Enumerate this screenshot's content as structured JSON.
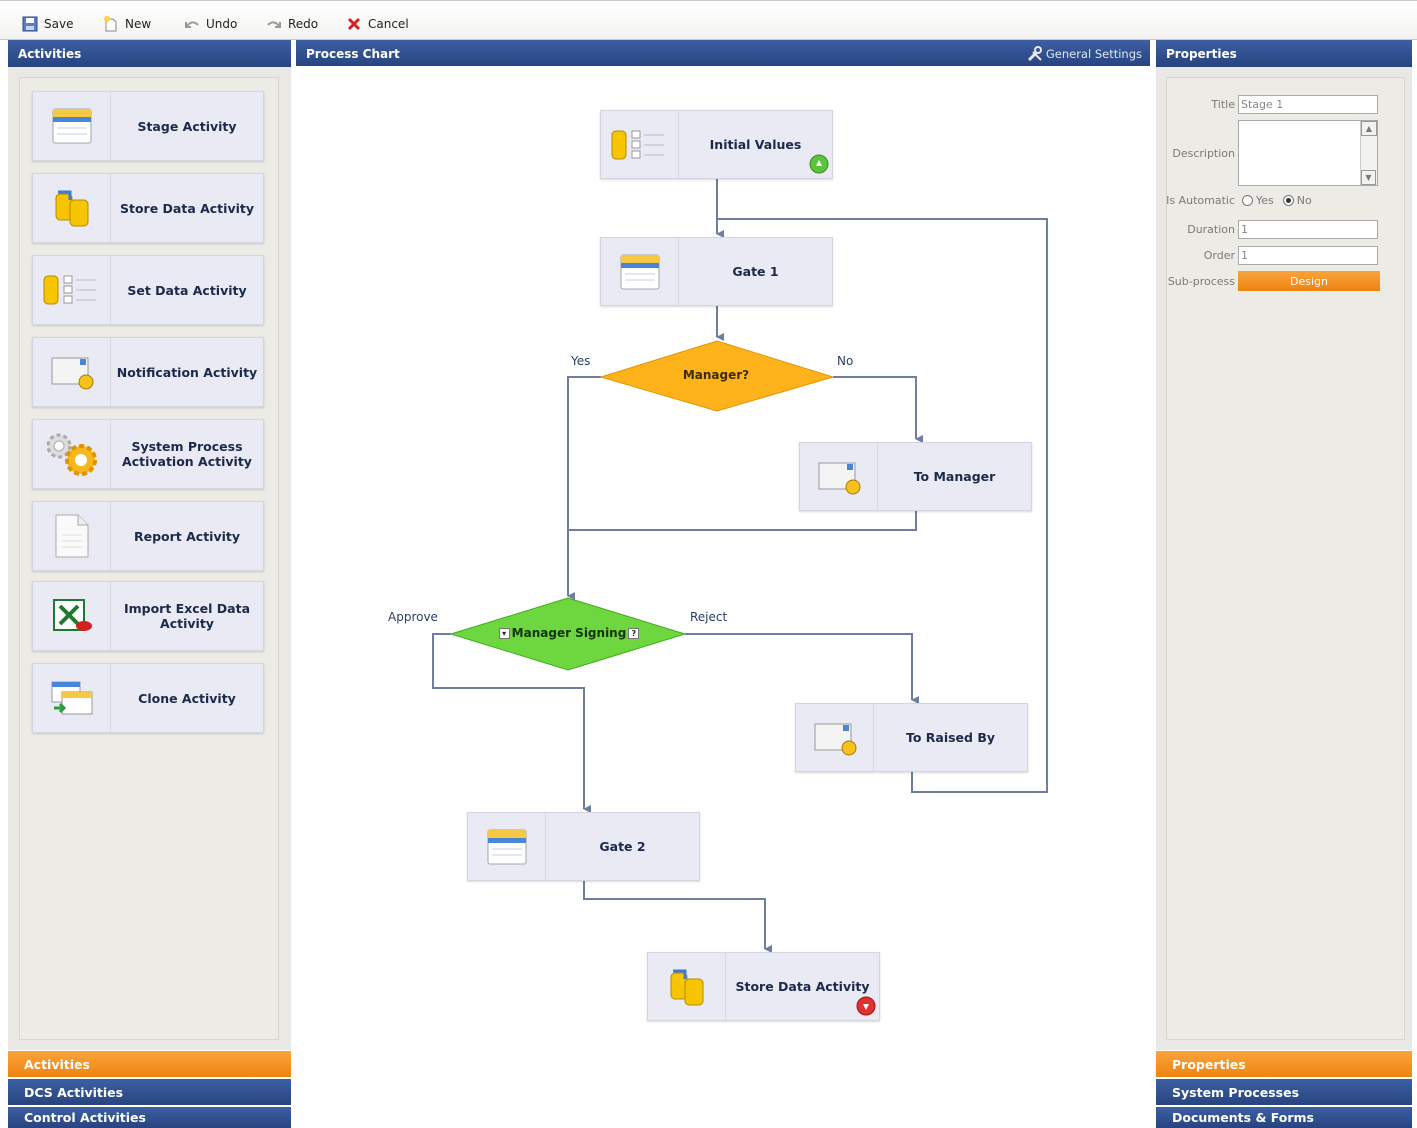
{
  "toolbar": {
    "save": "Save",
    "new": "New",
    "undo": "Undo",
    "redo": "Redo",
    "cancel": "Cancel"
  },
  "activities_panel": {
    "title": "Activities",
    "items": [
      {
        "label": "Stage Activity",
        "icon": "stage-icon"
      },
      {
        "label": "Store Data Activity",
        "icon": "store-data-icon"
      },
      {
        "label": "Set Data Activity",
        "icon": "set-data-icon"
      },
      {
        "label": "Notification Activity",
        "icon": "notification-icon"
      },
      {
        "label": "System Process Activation Activity",
        "icon": "gears-icon"
      },
      {
        "label": "Report Activity",
        "icon": "report-icon"
      },
      {
        "label": "Import Excel Data Activity",
        "icon": "excel-icon"
      },
      {
        "label": "Clone Activity",
        "icon": "clone-icon"
      }
    ],
    "footer": [
      "Activities",
      "DCS Activities",
      "Control Activities"
    ]
  },
  "chart_panel": {
    "title": "Process Chart",
    "general_settings": "General Settings",
    "nodes": {
      "initial": "Initial Values",
      "gate1": "Gate 1",
      "manager": "Manager?",
      "to_manager": "To Manager",
      "manager_signing": "Manager Signing",
      "to_raised_by": "To Raised By",
      "gate2": "Gate 2",
      "store_data": "Store Data Activity"
    },
    "edge_labels": {
      "yes": "Yes",
      "no": "No",
      "approve": "Approve",
      "reject": "Reject"
    }
  },
  "properties_panel": {
    "title": "Properties",
    "fields": {
      "title_label": "Title",
      "title_value": "Stage 1",
      "description_label": "Description",
      "description_value": "",
      "automatic_label": "Is Automatic",
      "yes": "Yes",
      "no": "No",
      "duration_label": "Duration",
      "duration_value": "1",
      "order_label": "Order",
      "order_value": "1",
      "subprocess_label": "Sub-process",
      "design_button": "Design"
    },
    "footer": [
      "Properties",
      "System Processes",
      "Documents & Forms"
    ]
  },
  "colors": {
    "header_blue": "#2f4f8f",
    "accent_orange": "#f29422",
    "decision_orange": "#ffb31a",
    "decision_green": "#6ed63e"
  }
}
